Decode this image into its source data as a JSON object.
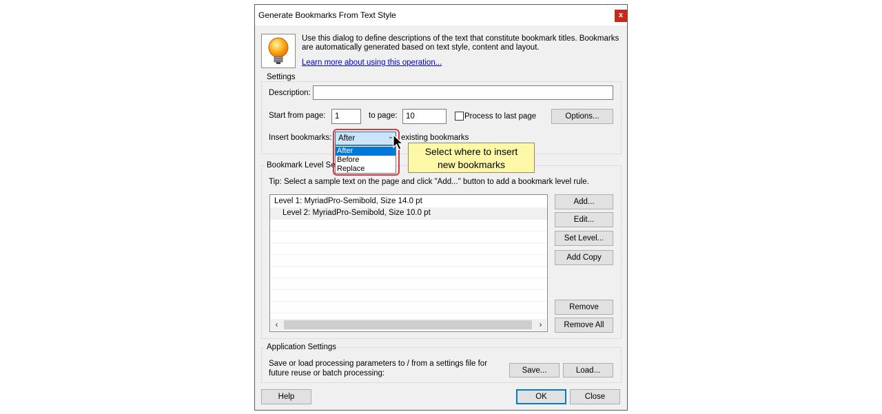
{
  "dialog": {
    "title": "Generate Bookmarks From Text Style",
    "close_glyph": "x",
    "intro_text": "Use this dialog to define descriptions of the text that constitute bookmark titles. Bookmarks are automatically generated based on text style, content and layout.",
    "learn_link": "Learn more about using this operation..."
  },
  "settings": {
    "group_label": "Settings",
    "description_label": "Description:",
    "description_value": "",
    "start_page_label": "Start from page:",
    "start_page_value": "1",
    "to_page_label": "to page:",
    "to_page_value": "10",
    "process_last_label": "Process to last page",
    "process_last_checked": false,
    "options_button": "Options...",
    "insert_label": "Insert bookmarks:",
    "insert_selected": "After",
    "insert_options": [
      "After",
      "Before",
      "Replace"
    ],
    "existing_label": "existing bookmarks"
  },
  "tooltip": {
    "line1": "Select where to insert",
    "line2": "new bookmarks"
  },
  "levels": {
    "group_label": "Bookmark Level Setti",
    "tip": "Tip: Select a sample text on the page and click \"Add...\" button to add a bookmark level rule.",
    "rows": [
      "Level 1: MyriadPro-Semibold, Size 14.0 pt",
      "Level 2: MyriadPro-Semibold, Size 10.0 pt"
    ],
    "buttons": {
      "add": "Add...",
      "edit": "Edit...",
      "set_level": "Set Level...",
      "add_copy": "Add Copy",
      "remove": "Remove",
      "remove_all": "Remove All"
    }
  },
  "app_settings": {
    "group_label": "Application Settings",
    "text": "Save or load processing parameters to / from a settings file for future reuse or batch processing:",
    "save_button": "Save...",
    "load_button": "Load..."
  },
  "footer": {
    "help_button": "Help",
    "ok_button": "OK",
    "close_button": "Close"
  },
  "colors": {
    "accent": "#0078d7",
    "highlight_ring": "#d9363e",
    "tooltip_bg": "#fdf8a8",
    "close_red": "#c42b1c"
  }
}
